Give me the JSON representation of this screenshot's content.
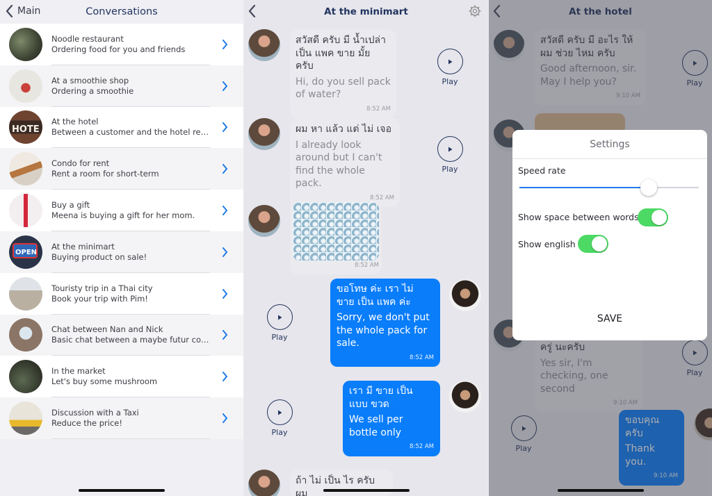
{
  "conversations_screen": {
    "back_label": "Main",
    "title": "Conversations",
    "items": [
      {
        "title": "Noodle restaurant",
        "subtitle": "Ordering food for you and friends"
      },
      {
        "title": "At a smoothie shop",
        "subtitle": "Ordering a smoothie"
      },
      {
        "title": "At the hotel",
        "subtitle": "Between a customer and the hotel rece..."
      },
      {
        "title": "Condo for rent",
        "subtitle": "Rent a room for short-term"
      },
      {
        "title": "Buy a gift",
        "subtitle": "Meena is buying a gift for her mom."
      },
      {
        "title": "At the minimart",
        "subtitle": "Buying product on sale!"
      },
      {
        "title": "Touristy trip in a Thai city",
        "subtitle": "Book your trip with Pim!"
      },
      {
        "title": "Chat between Nan and Nick",
        "subtitle": "Basic chat between a maybe futur coupl..."
      },
      {
        "title": "In the market",
        "subtitle": "Let's buy some mushroom"
      },
      {
        "title": "Discussion with a Taxi",
        "subtitle": "Reduce the price!"
      }
    ]
  },
  "minimart_screen": {
    "title": "At the minimart",
    "play_label": "Play",
    "messages": [
      {
        "thai": "สวัสดี ครับ  มี น้ำเปล่า เป็น แพค ขาย มั้ย ครับ",
        "english": "Hi, do you sell pack of water?",
        "time": "8:52 AM"
      },
      {
        "thai": "ผม หา แล้ว แต่ ไม่ เจอ",
        "english": "I already look around but I can't find the whole pack.",
        "time": "8:52 AM"
      },
      {
        "time": "8:52 AM"
      },
      {
        "thai": "ขอโทษ ค่ะ  เรา ไม่ ขาย เป็น แพค ค่ะ",
        "english": "Sorry, we don't put the whole pack for sale.",
        "time": "8:52 AM"
      },
      {
        "thai": "เรา มี ขาย เป็น แบบ ขวด",
        "english": "We sell per bottle only",
        "time": "8:52 AM"
      },
      {
        "thai": "ถ้า ไม่ เป็น ไร ครับ ผม"
      }
    ]
  },
  "hotel_screen": {
    "title": "At the hotel",
    "play_label": "Play",
    "messages": [
      {
        "thai": "สวัสดี ครับ มี อะไร ให้ ผม ช่วย ไหม ครับ",
        "english": "Good afternoon, sir. May I help you?",
        "time": "9:10 AM"
      },
      {
        "thai": "ครู่ นะครับ",
        "english": "Yes sir, I'm checking, one second",
        "time": "9:10 AM"
      },
      {
        "thai": "ขอบคุณ ครับ",
        "english": "Thank you.",
        "time": "9:10 AM"
      }
    ],
    "settings": {
      "title": "Settings",
      "speed_label": "Speed rate",
      "speed_value": 0.72,
      "space_label": "Show space between words",
      "space_on": true,
      "english_label": "Show english",
      "english_on": true,
      "save_label": "SAVE"
    }
  },
  "colors": {
    "accent": "#0a7dfa",
    "navy": "#22345f",
    "toggle_on": "#4cd964"
  }
}
